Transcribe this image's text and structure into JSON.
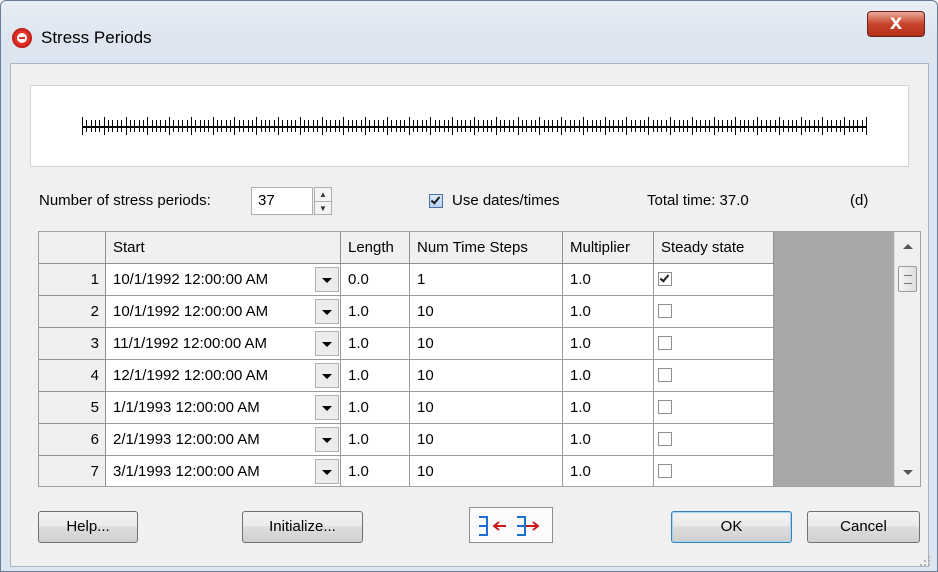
{
  "window": {
    "title": "Stress Periods",
    "close_glyph": "X"
  },
  "controls": {
    "num_periods_label": "Number of stress periods:",
    "num_periods_value": "37",
    "use_dates_label": "Use dates/times",
    "use_dates_checked": true,
    "total_time_label": "Total time: 37.0",
    "units_label": "(d)"
  },
  "table": {
    "columns": [
      "Start",
      "Length",
      "Num Time Steps",
      "Multiplier",
      "Steady state"
    ],
    "rows": [
      {
        "num": "1",
        "start": "10/1/1992 12:00:00 AM",
        "length": "0.0",
        "steps": "1",
        "multiplier": "1.0",
        "steady": true
      },
      {
        "num": "2",
        "start": "10/1/1992 12:00:00 AM",
        "length": "1.0",
        "steps": "10",
        "multiplier": "1.0",
        "steady": false
      },
      {
        "num": "3",
        "start": "11/1/1992 12:00:00 AM",
        "length": "1.0",
        "steps": "10",
        "multiplier": "1.0",
        "steady": false
      },
      {
        "num": "4",
        "start": "12/1/1992 12:00:00 AM",
        "length": "1.0",
        "steps": "10",
        "multiplier": "1.0",
        "steady": false
      },
      {
        "num": "5",
        "start": "1/1/1993 12:00:00 AM",
        "length": "1.0",
        "steps": "10",
        "multiplier": "1.0",
        "steady": false
      },
      {
        "num": "6",
        "start": "2/1/1993 12:00:00 AM",
        "length": "1.0",
        "steps": "10",
        "multiplier": "1.0",
        "steady": false
      },
      {
        "num": "7",
        "start": "3/1/1993 12:00:00 AM",
        "length": "1.0",
        "steps": "10",
        "multiplier": "1.0",
        "steady": false
      }
    ]
  },
  "buttons": {
    "help": "Help...",
    "initialize": "Initialize...",
    "ok": "OK",
    "cancel": "Cancel"
  },
  "icons": {
    "app": "stress-periods-app-icon",
    "close": "close-icon",
    "toolbar": "insert-delete-rows-icon"
  },
  "colors": {
    "close_button": "#c8452c",
    "grid_background": "#a8a8a8"
  }
}
